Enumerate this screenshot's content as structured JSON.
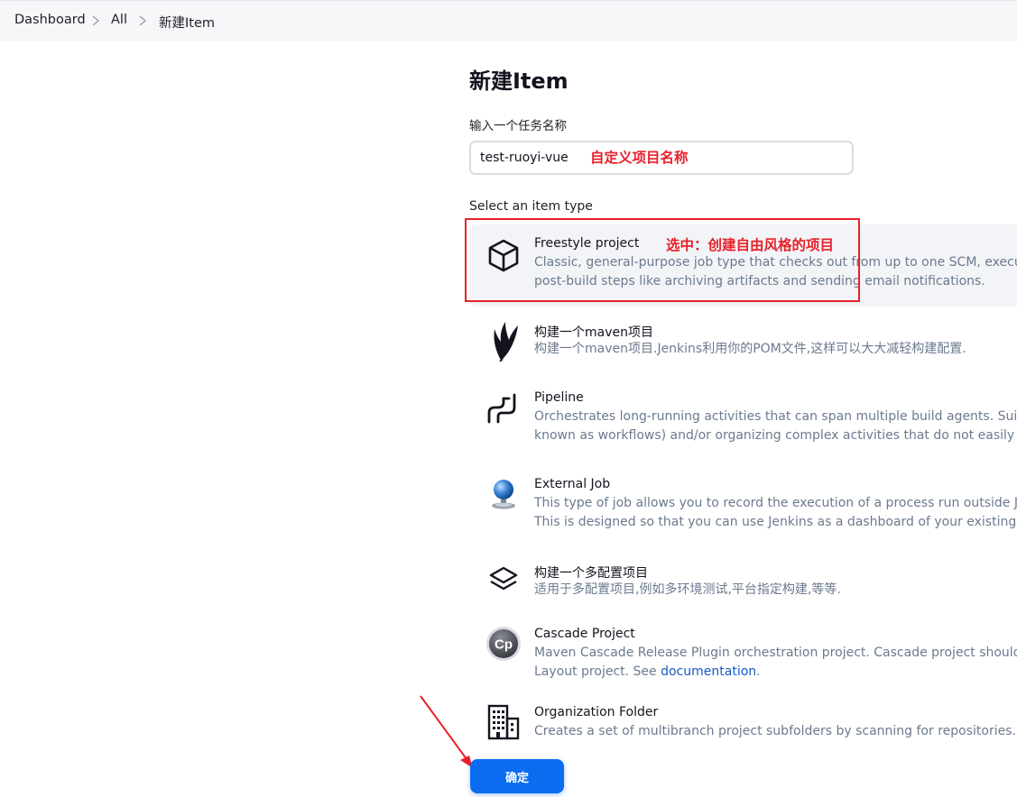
{
  "breadcrumb": {
    "items": [
      {
        "label": "Dashboard"
      },
      {
        "label": "All"
      },
      {
        "label": "新建Item"
      }
    ]
  },
  "page": {
    "title": "新建Item",
    "name_label": "输入一个任务名称",
    "name_value": "test-ruoyi-vue",
    "type_label": "Select an item type",
    "ok_label": "确定"
  },
  "annotations": {
    "name_note": "自定义项目名称",
    "type_note": "选中：创建自由风格的项目",
    "color": "#e8202a"
  },
  "item_types": [
    {
      "title": "Freestyle project",
      "icon": "cube-icon",
      "desc": [
        "Classic, general-purpose job type that checks out from up to one SCM, executes",
        "post-build steps like archiving artifacts and sending email notifications."
      ]
    },
    {
      "title": "构建一个maven项目",
      "icon": "maven-feather-icon",
      "desc": [
        "构建一个maven项目.Jenkins利用你的POM文件,这样可以大大减轻构建配置."
      ]
    },
    {
      "title": "Pipeline",
      "icon": "pipeline-icon",
      "desc": [
        "Orchestrates long-running activities that can span multiple build agents. Suitabl",
        "known as workflows) and/or organizing complex activities that do not easily fit i"
      ]
    },
    {
      "title": "External Job",
      "icon": "globe-monitor-icon",
      "desc": [
        "This type of job allows you to record the execution of a process run outside Jenk",
        "This is designed so that you can use Jenkins as a dashboard of your existing auto"
      ]
    },
    {
      "title": "构建一个多配置项目",
      "icon": "layers-icon",
      "desc": [
        "适用于多配置项目,例如多环境测试,平台指定构建,等等."
      ]
    },
    {
      "title": "Cascade Project",
      "icon": "cascade-cp-icon",
      "desc": [
        "Maven Cascade Release Plugin orchestration project. Cascade project should be",
        "Layout project. See "
      ],
      "link": "documentation",
      "after_link": "."
    },
    {
      "title": "Organization Folder",
      "icon": "building-icon",
      "desc": [
        "Creates a set of multibranch project subfolders by scanning for repositories."
      ]
    }
  ],
  "colors": {
    "accent": "#0b6cf0",
    "selected_bg": "#f2f4f7",
    "desc_text": "#6b7a8f",
    "link": "#1659c7"
  }
}
